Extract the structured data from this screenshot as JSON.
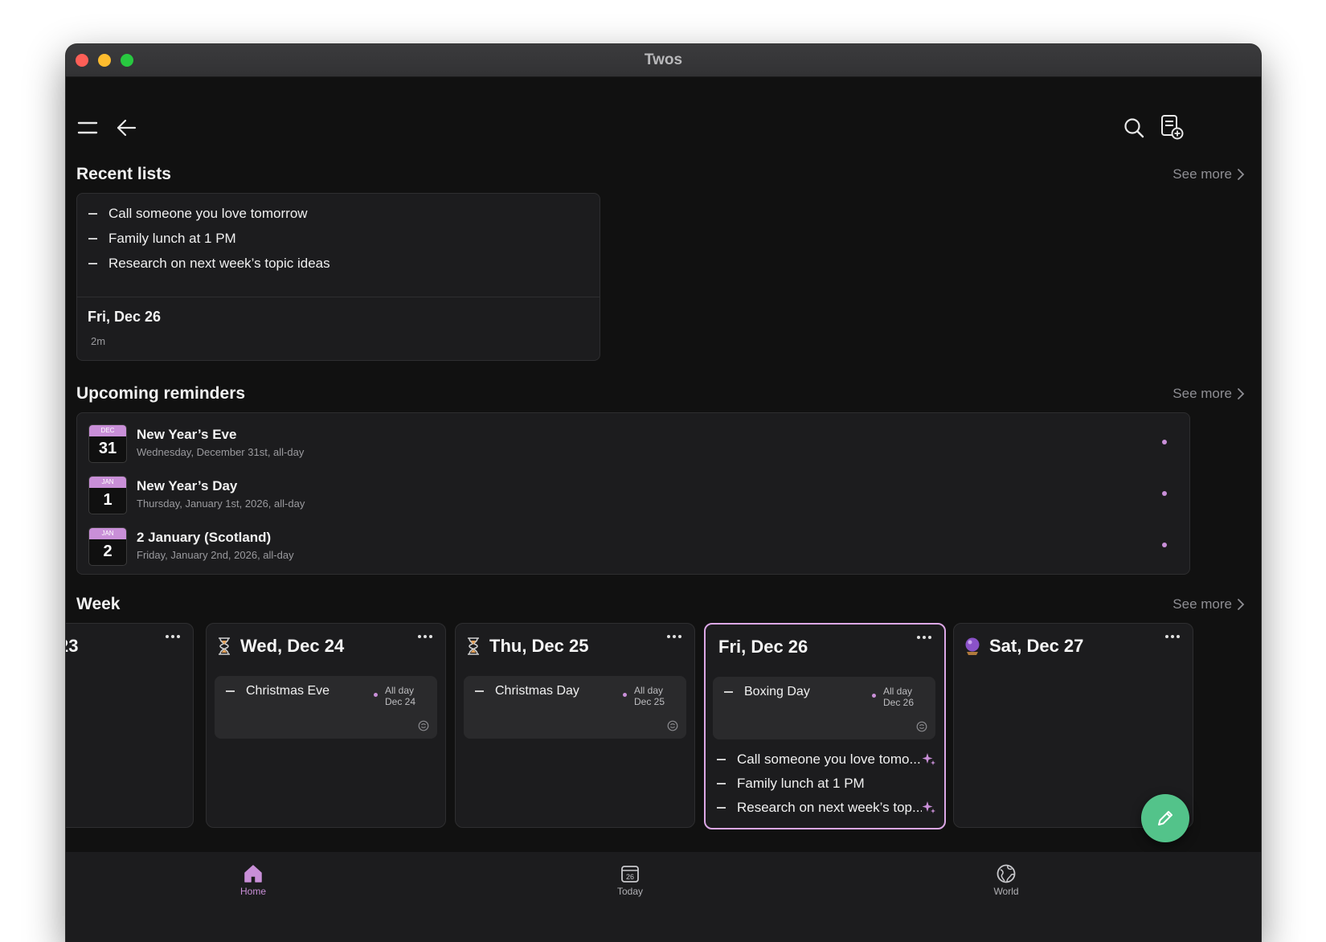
{
  "window": {
    "title": "Twos"
  },
  "toolbar": {
    "menu_icon": "hamburger-menu-icon",
    "back_icon": "back-arrow-icon",
    "search_icon": "search-icon",
    "new_list_icon": "new-list-icon"
  },
  "recent_lists": {
    "title": "Recent lists",
    "see_more": "See more",
    "card": {
      "items": [
        "Call someone you love tomorrow",
        "Family lunch at 1 PM",
        "Research on next week’s topic ideas"
      ],
      "date": "Fri, Dec 26",
      "age": "2m"
    }
  },
  "reminders": {
    "title": "Upcoming reminders",
    "see_more": "See more",
    "items": [
      {
        "month": "DEC",
        "day": "31",
        "title": "New Year’s Eve",
        "subtitle": "Wednesday, December 31st, all-day"
      },
      {
        "month": "JAN",
        "day": "1",
        "title": "New Year’s Day",
        "subtitle": "Thursday, January 1st, 2026, all-day"
      },
      {
        "month": "JAN",
        "day": "2",
        "title": "2 January (Scotland)",
        "subtitle": "Friday, January 2nd, 2026, all-day"
      }
    ],
    "accent": "#c98fd8"
  },
  "week": {
    "title": "Week",
    "see_more": "See more",
    "days": [
      {
        "title": "23"
      },
      {
        "title": "Wed, Dec 24",
        "icon": "hourglass-icon",
        "event": {
          "name": "Christmas Eve",
          "time1": "All day",
          "time2": "Dec 24"
        }
      },
      {
        "title": "Thu, Dec 25",
        "icon": "hourglass-icon",
        "event": {
          "name": "Christmas Day",
          "time1": "All day",
          "time2": "Dec 25"
        }
      },
      {
        "title": "Fri, Dec 26",
        "event": {
          "name": "Boxing Day",
          "time1": "All day",
          "time2": "Dec 26"
        },
        "tasks": [
          "Call someone you love tomo...",
          "Family lunch at 1 PM",
          "Research on next week’s top..."
        ]
      },
      {
        "title": "Sat, Dec 27",
        "icon": "crystal-ball-icon"
      }
    ]
  },
  "fab": {
    "icon": "pencil-icon",
    "color": "#53c38a"
  },
  "nav": {
    "items": [
      {
        "label": "Home",
        "icon": "home-icon"
      },
      {
        "label": "Today",
        "icon": "calendar-icon",
        "badge": "26"
      },
      {
        "label": "World",
        "icon": "globe-icon"
      }
    ]
  }
}
